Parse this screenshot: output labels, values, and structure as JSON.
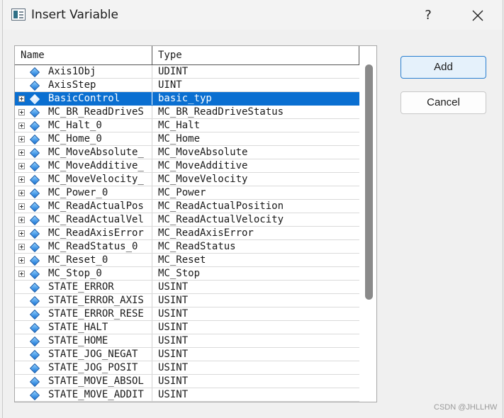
{
  "window": {
    "title": "Insert Variable",
    "help_label": "?",
    "app_icon": "variable-dialog-icon",
    "close_icon": "close-icon"
  },
  "list": {
    "columns": [
      "Name",
      "Type"
    ],
    "rows": [
      {
        "name": "Axis1Obj",
        "type": "UDINT",
        "expandable": false,
        "selected": false
      },
      {
        "name": "AxisStep",
        "type": "UINT",
        "expandable": false,
        "selected": false
      },
      {
        "name": "BasicControl",
        "type": "basic_typ",
        "expandable": true,
        "selected": true
      },
      {
        "name": "MC_BR_ReadDriveS",
        "type": "MC_BR_ReadDriveStatus",
        "expandable": true,
        "selected": false
      },
      {
        "name": "MC_Halt_0",
        "type": "MC_Halt",
        "expandable": true,
        "selected": false
      },
      {
        "name": "MC_Home_0",
        "type": "MC_Home",
        "expandable": true,
        "selected": false
      },
      {
        "name": "MC_MoveAbsolute_",
        "type": "MC_MoveAbsolute",
        "expandable": true,
        "selected": false
      },
      {
        "name": "MC_MoveAdditive_",
        "type": "MC_MoveAdditive",
        "expandable": true,
        "selected": false
      },
      {
        "name": "MC_MoveVelocity_",
        "type": "MC_MoveVelocity",
        "expandable": true,
        "selected": false
      },
      {
        "name": "MC_Power_0",
        "type": "MC_Power",
        "expandable": true,
        "selected": false
      },
      {
        "name": "MC_ReadActualPos",
        "type": "MC_ReadActualPosition",
        "expandable": true,
        "selected": false
      },
      {
        "name": "MC_ReadActualVel",
        "type": "MC_ReadActualVelocity",
        "expandable": true,
        "selected": false
      },
      {
        "name": "MC_ReadAxisError",
        "type": "MC_ReadAxisError",
        "expandable": true,
        "selected": false
      },
      {
        "name": "MC_ReadStatus_0",
        "type": "MC_ReadStatus",
        "expandable": true,
        "selected": false
      },
      {
        "name": "MC_Reset_0",
        "type": "MC_Reset",
        "expandable": true,
        "selected": false
      },
      {
        "name": "MC_Stop_0",
        "type": "MC_Stop",
        "expandable": true,
        "selected": false
      },
      {
        "name": "STATE_ERROR",
        "type": "USINT",
        "expandable": false,
        "selected": false
      },
      {
        "name": "STATE_ERROR_AXIS",
        "type": "USINT",
        "expandable": false,
        "selected": false
      },
      {
        "name": "STATE_ERROR_RESE",
        "type": "USINT",
        "expandable": false,
        "selected": false
      },
      {
        "name": "STATE_HALT",
        "type": "USINT",
        "expandable": false,
        "selected": false
      },
      {
        "name": "STATE_HOME",
        "type": "USINT",
        "expandable": false,
        "selected": false
      },
      {
        "name": "STATE_JOG_NEGAT",
        "type": "USINT",
        "expandable": false,
        "selected": false
      },
      {
        "name": "STATE_JOG_POSIT",
        "type": "USINT",
        "expandable": false,
        "selected": false
      },
      {
        "name": "STATE_MOVE_ABSOL",
        "type": "USINT",
        "expandable": false,
        "selected": false
      },
      {
        "name": "STATE_MOVE_ADDIT",
        "type": "USINT",
        "expandable": false,
        "selected": false
      }
    ]
  },
  "buttons": {
    "add_label": "Add",
    "cancel_label": "Cancel"
  },
  "watermark": "CSDN @JHLLHW",
  "colors": {
    "selection": "#0a6fd1",
    "default_button_border": "#2a7fd0",
    "variable_icon": "#1673d6"
  }
}
